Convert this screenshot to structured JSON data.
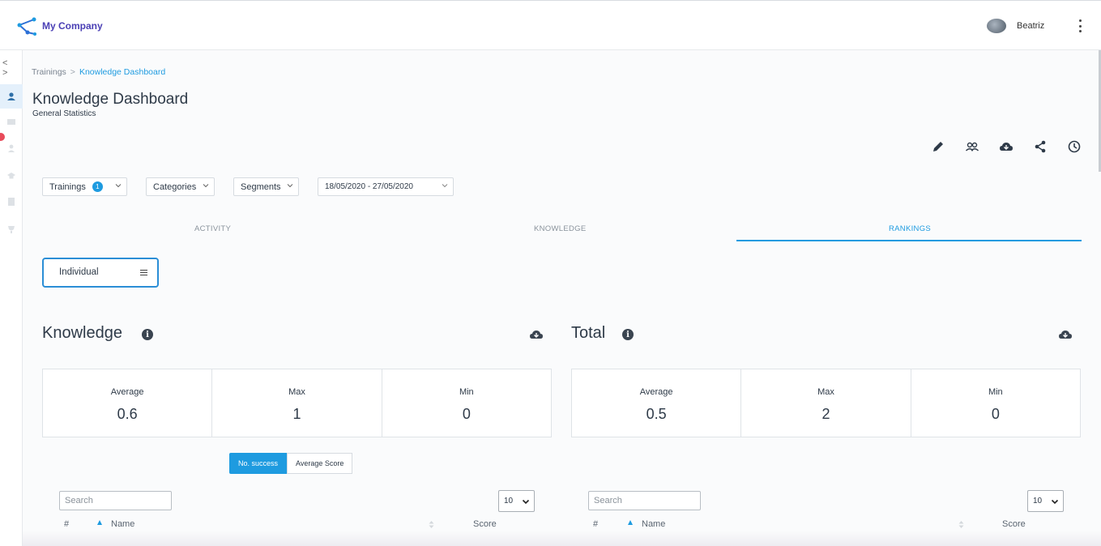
{
  "header": {
    "brand": "My Company",
    "user_name": "Beatriz"
  },
  "breadcrumb": {
    "items": [
      "Trainings",
      "Knowledge Dashboard"
    ]
  },
  "page": {
    "title": "Knowledge Dashboard",
    "subtitle": "General Statistics"
  },
  "toolbar_icons": [
    "edit-icon",
    "users-icon",
    "cloud-download-icon",
    "share-icon",
    "history-icon"
  ],
  "filters": {
    "trainings_label": "Trainings",
    "trainings_count": "1",
    "categories_label": "Categories",
    "segments_label": "Segments",
    "date_range": "18/05/2020 - 27/05/2020"
  },
  "tabs": [
    {
      "label": "ACTIVITY",
      "active": false
    },
    {
      "label": "KNOWLEDGE",
      "active": false
    },
    {
      "label": "RANKINGS",
      "active": true
    }
  ],
  "view_select": "Individual",
  "knowledge": {
    "title": "Knowledge",
    "stats": [
      {
        "label": "Average",
        "value": "0.6"
      },
      {
        "label": "Max",
        "value": "1"
      },
      {
        "label": "Min",
        "value": "0"
      }
    ],
    "search_placeholder": "Search",
    "page_size": "10",
    "columns": [
      "#",
      "Name",
      "Score"
    ]
  },
  "total": {
    "title": "Total",
    "stats": [
      {
        "label": "Average",
        "value": "0.5"
      },
      {
        "label": "Max",
        "value": "2"
      },
      {
        "label": "Min",
        "value": "0"
      }
    ],
    "search_placeholder": "Search",
    "page_size": "10",
    "columns": [
      "#",
      "Name",
      "Score"
    ]
  },
  "metric_toggle": {
    "options": [
      "No. success",
      "Average Score"
    ],
    "selected": "No. success"
  },
  "colors": {
    "accent": "#1e9be0",
    "brand": "#4a3fb5",
    "text": "#2e3a48",
    "badge_red": "#e84b5a"
  }
}
